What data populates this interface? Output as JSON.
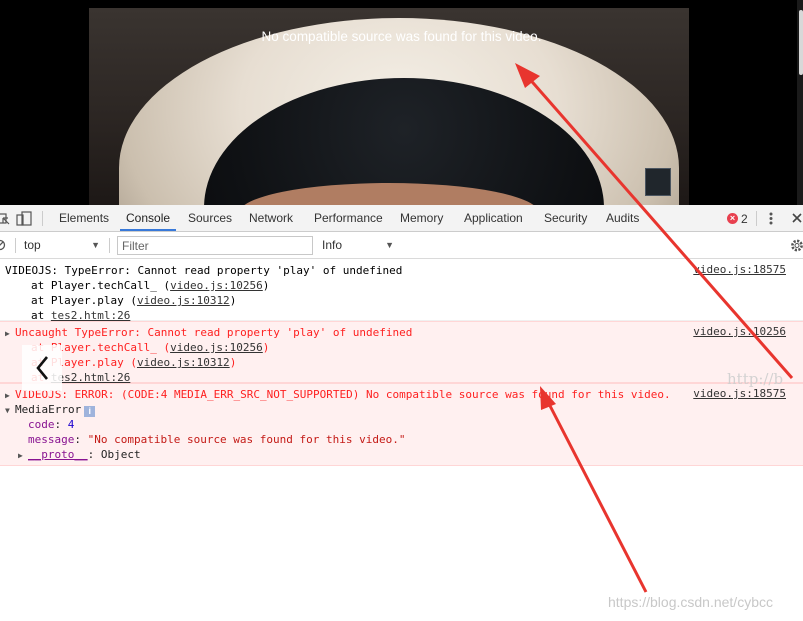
{
  "video": {
    "error_message": "No compatible source was found for this video."
  },
  "devtools": {
    "tabs": [
      {
        "label": "Elements"
      },
      {
        "label": "Console"
      },
      {
        "label": "Sources"
      },
      {
        "label": "Network"
      },
      {
        "label": "Performance"
      },
      {
        "label": "Memory"
      },
      {
        "label": "Application"
      },
      {
        "label": "Security"
      },
      {
        "label": "Audits"
      }
    ],
    "active_tab": "Console",
    "error_count": "2",
    "error_count_color": "#e8404f"
  },
  "filterbar": {
    "context": "top",
    "filter_placeholder": "Filter",
    "level": "Info"
  },
  "console": {
    "msg1": {
      "text": "VIDEOJS: TypeError: Cannot read property 'play' of undefined",
      "source": "video.js:18575",
      "stack": [
        {
          "prefix": "at Player.techCall_ (",
          "link": "video.js:10256",
          "suffix": ")"
        },
        {
          "prefix": "at Player.play (",
          "link": "video.js:10312",
          "suffix": ")"
        },
        {
          "prefix": "at ",
          "link": "tes2.html:26",
          "suffix": ""
        }
      ]
    },
    "msg2": {
      "text": "Uncaught TypeError: Cannot read property 'play' of undefined",
      "source": "video.js:10256",
      "stack": [
        {
          "prefix": "at Player.techCall_ (",
          "link": "video.js:10256",
          "suffix": ")"
        },
        {
          "prefix": "at Player.play (",
          "link": "video.js:10312",
          "suffix": ")"
        },
        {
          "prefix": "at ",
          "link": "tes2.html:26",
          "suffix": ""
        }
      ]
    },
    "msg3": {
      "text": "VIDEOJS: ERROR: (CODE:4 MEDIA_ERR_SRC_NOT_SUPPORTED) No compatible source was found for this video.",
      "source": "video.js:18575",
      "object_name": "MediaError",
      "code_key": "code",
      "code_value": "4",
      "message_key": "message",
      "message_value": "\"No compatible source was found for this video.\"",
      "proto_key": "__proto__",
      "proto_value": "Object"
    }
  },
  "overlay": {
    "watermark_mid": "http://b",
    "watermark": "https://blog.csdn.net/cybcc",
    "arrow_color": "#e8352e"
  }
}
